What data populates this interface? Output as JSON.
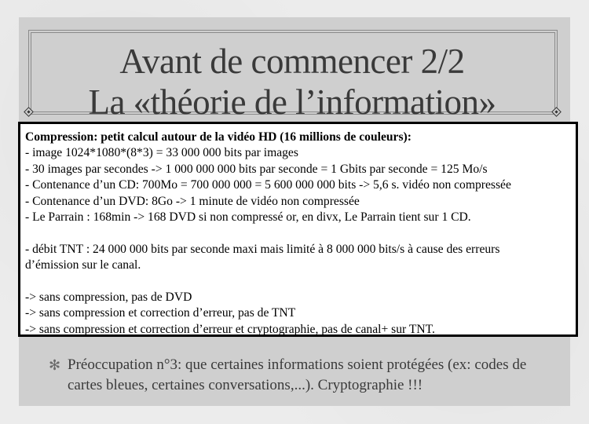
{
  "title": {
    "line1": "Avant de commencer 2/2",
    "line2": "La «théorie de l’information»"
  },
  "content": {
    "heading": "Compression: petit calcul autour de la vidéo HD (16 millions de couleurs):",
    "lines": [
      " - image 1024*1080*(8*3) = 33 000 000 bits par images",
      " - 30 images par secondes -> 1 000 000 000 bits par seconde = 1 Gbits par seconde = 125 Mo/s",
      " - Contenance d’un CD: 700Mo = 700 000 000 = 5 600 000 000 bits -> 5,6 s. vidéo non compressée",
      " - Contenance d’un DVD: 8Go -> 1 minute de vidéo non compressée",
      " - Le Parrain : 168min -> 168 DVD si non compressé or, en divx, Le Parrain tient sur 1 CD."
    ],
    "tnt_line1": " - débit TNT : 24 000 000 bits par seconde maxi mais limité à 8 000 000 bits/s à cause des erreurs",
    "tnt_line2": "d’émission sur le canal.",
    "conclusions": [
      "-> sans compression, pas de DVD",
      "-> sans compression et correction d’erreur, pas de TNT",
      "-> sans compression et correction d’erreur et cryptographie, pas de canal+ sur TNT."
    ]
  },
  "bullet": {
    "icon": "asterisk-bullet-icon",
    "text": "Préoccupation n°3: que certaines informations soient protégées (ex: codes de cartes bleues, certaines conversations,...). Cryptographie !!!"
  }
}
